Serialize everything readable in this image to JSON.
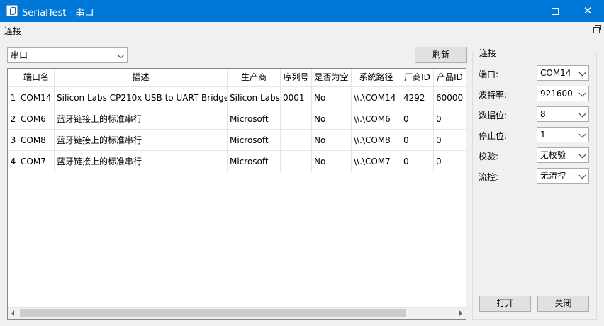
{
  "window": {
    "title": "SerialTest - 串口"
  },
  "dock": {
    "title": "连接"
  },
  "left": {
    "type_select": "串口",
    "refresh_label": "刷新",
    "table": {
      "headers": [
        "端口名",
        "描述",
        "生产商",
        "序列号",
        "是否为空",
        "系统路径",
        "厂商ID",
        "产品ID"
      ],
      "rows": [
        {
          "num": "1",
          "cells": [
            "COM14",
            "Silicon Labs CP210x USB to UART Bridge",
            "Silicon Labs",
            "0001",
            "No",
            "\\\\.\\COM14",
            "4292",
            "60000"
          ]
        },
        {
          "num": "2",
          "cells": [
            "COM6",
            "蓝牙链接上的标准串行",
            "Microsoft",
            "",
            "No",
            "\\\\.\\COM6",
            "0",
            "0"
          ]
        },
        {
          "num": "3",
          "cells": [
            "COM8",
            "蓝牙链接上的标准串行",
            "Microsoft",
            "",
            "No",
            "\\\\.\\COM8",
            "0",
            "0"
          ]
        },
        {
          "num": "4",
          "cells": [
            "COM7",
            "蓝牙链接上的标准串行",
            "Microsoft",
            "",
            "No",
            "\\\\.\\COM7",
            "0",
            "0"
          ]
        }
      ]
    }
  },
  "right": {
    "group_title": "连接",
    "fields": [
      {
        "label": "端口:",
        "value": "COM14"
      },
      {
        "label": "波特率:",
        "value": "921600"
      },
      {
        "label": "数据位:",
        "value": "8"
      },
      {
        "label": "停止位:",
        "value": "1"
      },
      {
        "label": "校验:",
        "value": "无校验"
      },
      {
        "label": "流控:",
        "value": "无流控"
      }
    ],
    "open_label": "打开",
    "close_label": "关闭"
  }
}
